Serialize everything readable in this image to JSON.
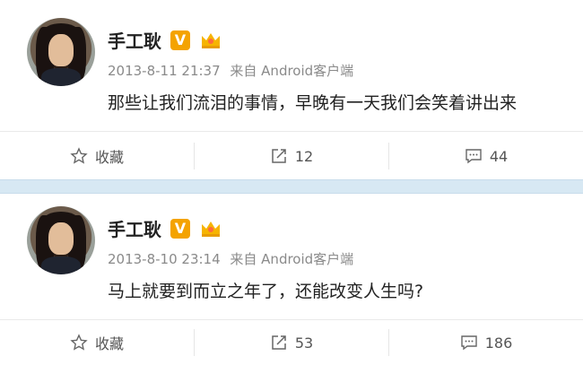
{
  "posts": [
    {
      "username": "手工耿",
      "verified_badge": "V",
      "date": "2013-8-11 21:37",
      "source": "来自 Android客户端",
      "content": "那些让我们流泪的事情，早晚有一天我们会笑着讲出来",
      "actions": {
        "favorite_label": "收藏",
        "repost_count": "12",
        "comment_count": "44"
      }
    },
    {
      "username": "手工耿",
      "verified_badge": "V",
      "date": "2013-8-10 23:14",
      "source": "来自 Android客户端",
      "content": "马上就要到而立之年了，还能改变人生吗?",
      "actions": {
        "favorite_label": "收藏",
        "repost_count": "53",
        "comment_count": "186"
      }
    }
  ],
  "colors": {
    "badge": "#f4a300",
    "separator": "#d7e8f3"
  }
}
